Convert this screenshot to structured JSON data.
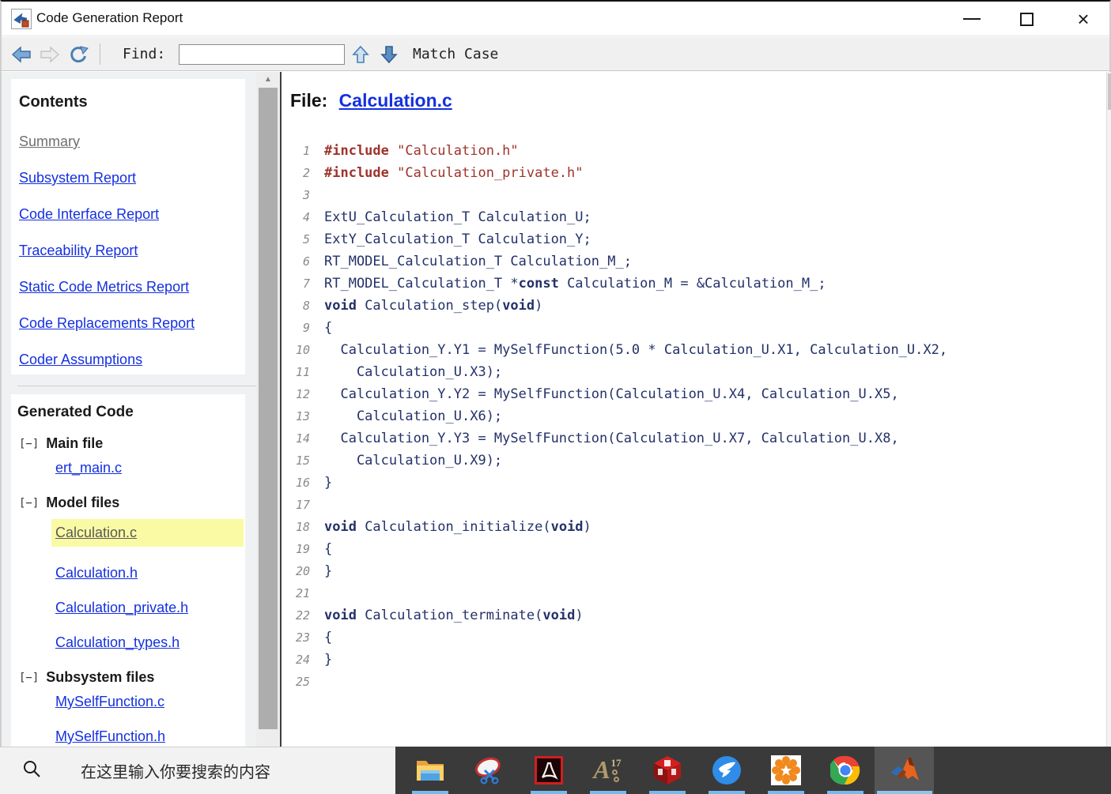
{
  "titlebar": {
    "title": "Code Generation Report"
  },
  "window_controls": {
    "minimize": "—",
    "maximize": "",
    "close": "×"
  },
  "toolbar": {
    "find_label": "Find:",
    "find_value": "",
    "match_case_label": "Match Case",
    "icons": [
      "back-icon",
      "forward-icon",
      "refresh-icon",
      "find-previous-icon",
      "find-next-icon"
    ]
  },
  "sidebar": {
    "contents": {
      "title": "Contents",
      "links": [
        {
          "label": "Summary",
          "visited": true
        },
        {
          "label": "Subsystem Report",
          "visited": false
        },
        {
          "label": "Code Interface Report",
          "visited": false
        },
        {
          "label": "Traceability Report",
          "visited": false
        },
        {
          "label": "Static Code Metrics Report",
          "visited": false
        },
        {
          "label": "Code Replacements Report",
          "visited": false
        },
        {
          "label": "Coder Assumptions",
          "visited": false
        }
      ]
    },
    "generated_code": {
      "title": "Generated Code",
      "groups": [
        {
          "toggle": "[−]",
          "label": "Main file",
          "files": [
            {
              "label": "ert_main.c",
              "selected": false
            }
          ]
        },
        {
          "toggle": "[−]",
          "label": "Model files",
          "files": [
            {
              "label": "Calculation.c",
              "selected": true
            },
            {
              "label": "Calculation.h",
              "selected": false
            },
            {
              "label": "Calculation_private.h",
              "selected": false
            },
            {
              "label": "Calculation_types.h",
              "selected": false
            }
          ]
        },
        {
          "toggle": "[−]",
          "label": "Subsystem files",
          "files": [
            {
              "label": "MySelfFunction.c",
              "selected": false
            },
            {
              "label": "MySelfFunction.h",
              "selected": false
            }
          ]
        }
      ]
    }
  },
  "main": {
    "file_prefix": "File:",
    "file_link": "Calculation.c"
  },
  "code": {
    "lines": [
      {
        "n": "1",
        "s": [
          [
            "pp",
            "#include "
          ],
          [
            "str",
            "\"Calculation.h\""
          ]
        ]
      },
      {
        "n": "2",
        "s": [
          [
            "pp",
            "#include "
          ],
          [
            "str",
            "\"Calculation_private.h\""
          ]
        ]
      },
      {
        "n": "3",
        "s": []
      },
      {
        "n": "4",
        "s": [
          [
            "p",
            "ExtU_Calculation_T Calculation_U;"
          ]
        ]
      },
      {
        "n": "5",
        "s": [
          [
            "p",
            "ExtY_Calculation_T Calculation_Y;"
          ]
        ]
      },
      {
        "n": "6",
        "s": [
          [
            "p",
            "RT_MODEL_Calculation_T Calculation_M_;"
          ]
        ]
      },
      {
        "n": "7",
        "s": [
          [
            "p",
            "RT_MODEL_Calculation_T *"
          ],
          [
            "kw",
            "const"
          ],
          [
            "p",
            " Calculation_M = &Calculation_M_;"
          ]
        ]
      },
      {
        "n": "8",
        "s": [
          [
            "kw",
            "void"
          ],
          [
            "p",
            " Calculation_step("
          ],
          [
            "kw",
            "void"
          ],
          [
            "p",
            ")"
          ]
        ]
      },
      {
        "n": "9",
        "s": [
          [
            "p",
            "{"
          ]
        ]
      },
      {
        "n": "10",
        "s": [
          [
            "p",
            "  Calculation_Y.Y1 = MySelfFunction(5.0 * Calculation_U.X1, Calculation_U.X2,"
          ]
        ]
      },
      {
        "n": "11",
        "s": [
          [
            "p",
            "    Calculation_U.X3);"
          ]
        ]
      },
      {
        "n": "12",
        "s": [
          [
            "p",
            "  Calculation_Y.Y2 = MySelfFunction(Calculation_U.X4, Calculation_U.X5,"
          ]
        ]
      },
      {
        "n": "13",
        "s": [
          [
            "p",
            "    Calculation_U.X6);"
          ]
        ]
      },
      {
        "n": "14",
        "s": [
          [
            "p",
            "  Calculation_Y.Y3 = MySelfFunction(Calculation_U.X7, Calculation_U.X8,"
          ]
        ]
      },
      {
        "n": "15",
        "s": [
          [
            "p",
            "    Calculation_U.X9);"
          ]
        ]
      },
      {
        "n": "16",
        "s": [
          [
            "p",
            "}"
          ]
        ]
      },
      {
        "n": "17",
        "s": []
      },
      {
        "n": "18",
        "s": [
          [
            "kw",
            "void"
          ],
          [
            "p",
            " Calculation_initialize("
          ],
          [
            "kw",
            "void"
          ],
          [
            "p",
            ")"
          ]
        ]
      },
      {
        "n": "19",
        "s": [
          [
            "p",
            "{"
          ]
        ]
      },
      {
        "n": "20",
        "s": [
          [
            "p",
            "}"
          ]
        ]
      },
      {
        "n": "21",
        "s": []
      },
      {
        "n": "22",
        "s": [
          [
            "kw",
            "void"
          ],
          [
            "p",
            " Calculation_terminate("
          ],
          [
            "kw",
            "void"
          ],
          [
            "p",
            ")"
          ]
        ]
      },
      {
        "n": "23",
        "s": [
          [
            "p",
            "{"
          ]
        ]
      },
      {
        "n": "24",
        "s": [
          [
            "p",
            "}"
          ]
        ]
      },
      {
        "n": "25",
        "s": []
      }
    ]
  },
  "taskbar": {
    "search_placeholder": "在这里输入你要搜索的内容",
    "search_icon": "search-icon",
    "apps": [
      {
        "name": "file-explorer",
        "running": true,
        "active": false
      },
      {
        "name": "snipping-tool",
        "running": false,
        "active": false
      },
      {
        "name": "adobe-acrobat",
        "running": true,
        "active": false
      },
      {
        "name": "a17-app",
        "running": true,
        "active": false
      },
      {
        "name": "red-cube-app",
        "running": true,
        "active": false
      },
      {
        "name": "dingtalk",
        "running": true,
        "active": false
      },
      {
        "name": "orange-gear-app",
        "running": true,
        "active": false
      },
      {
        "name": "chrome",
        "running": true,
        "active": false
      },
      {
        "name": "matlab",
        "running": true,
        "active": true
      }
    ]
  },
  "colors": {
    "link_blue": "#1430df",
    "visited_gray": "#6f6f6f",
    "highlight_yellow": "#fafaa4",
    "code_navy": "#243169",
    "code_red": "#9e332b",
    "taskbar_indicator": "#76b9ed"
  }
}
